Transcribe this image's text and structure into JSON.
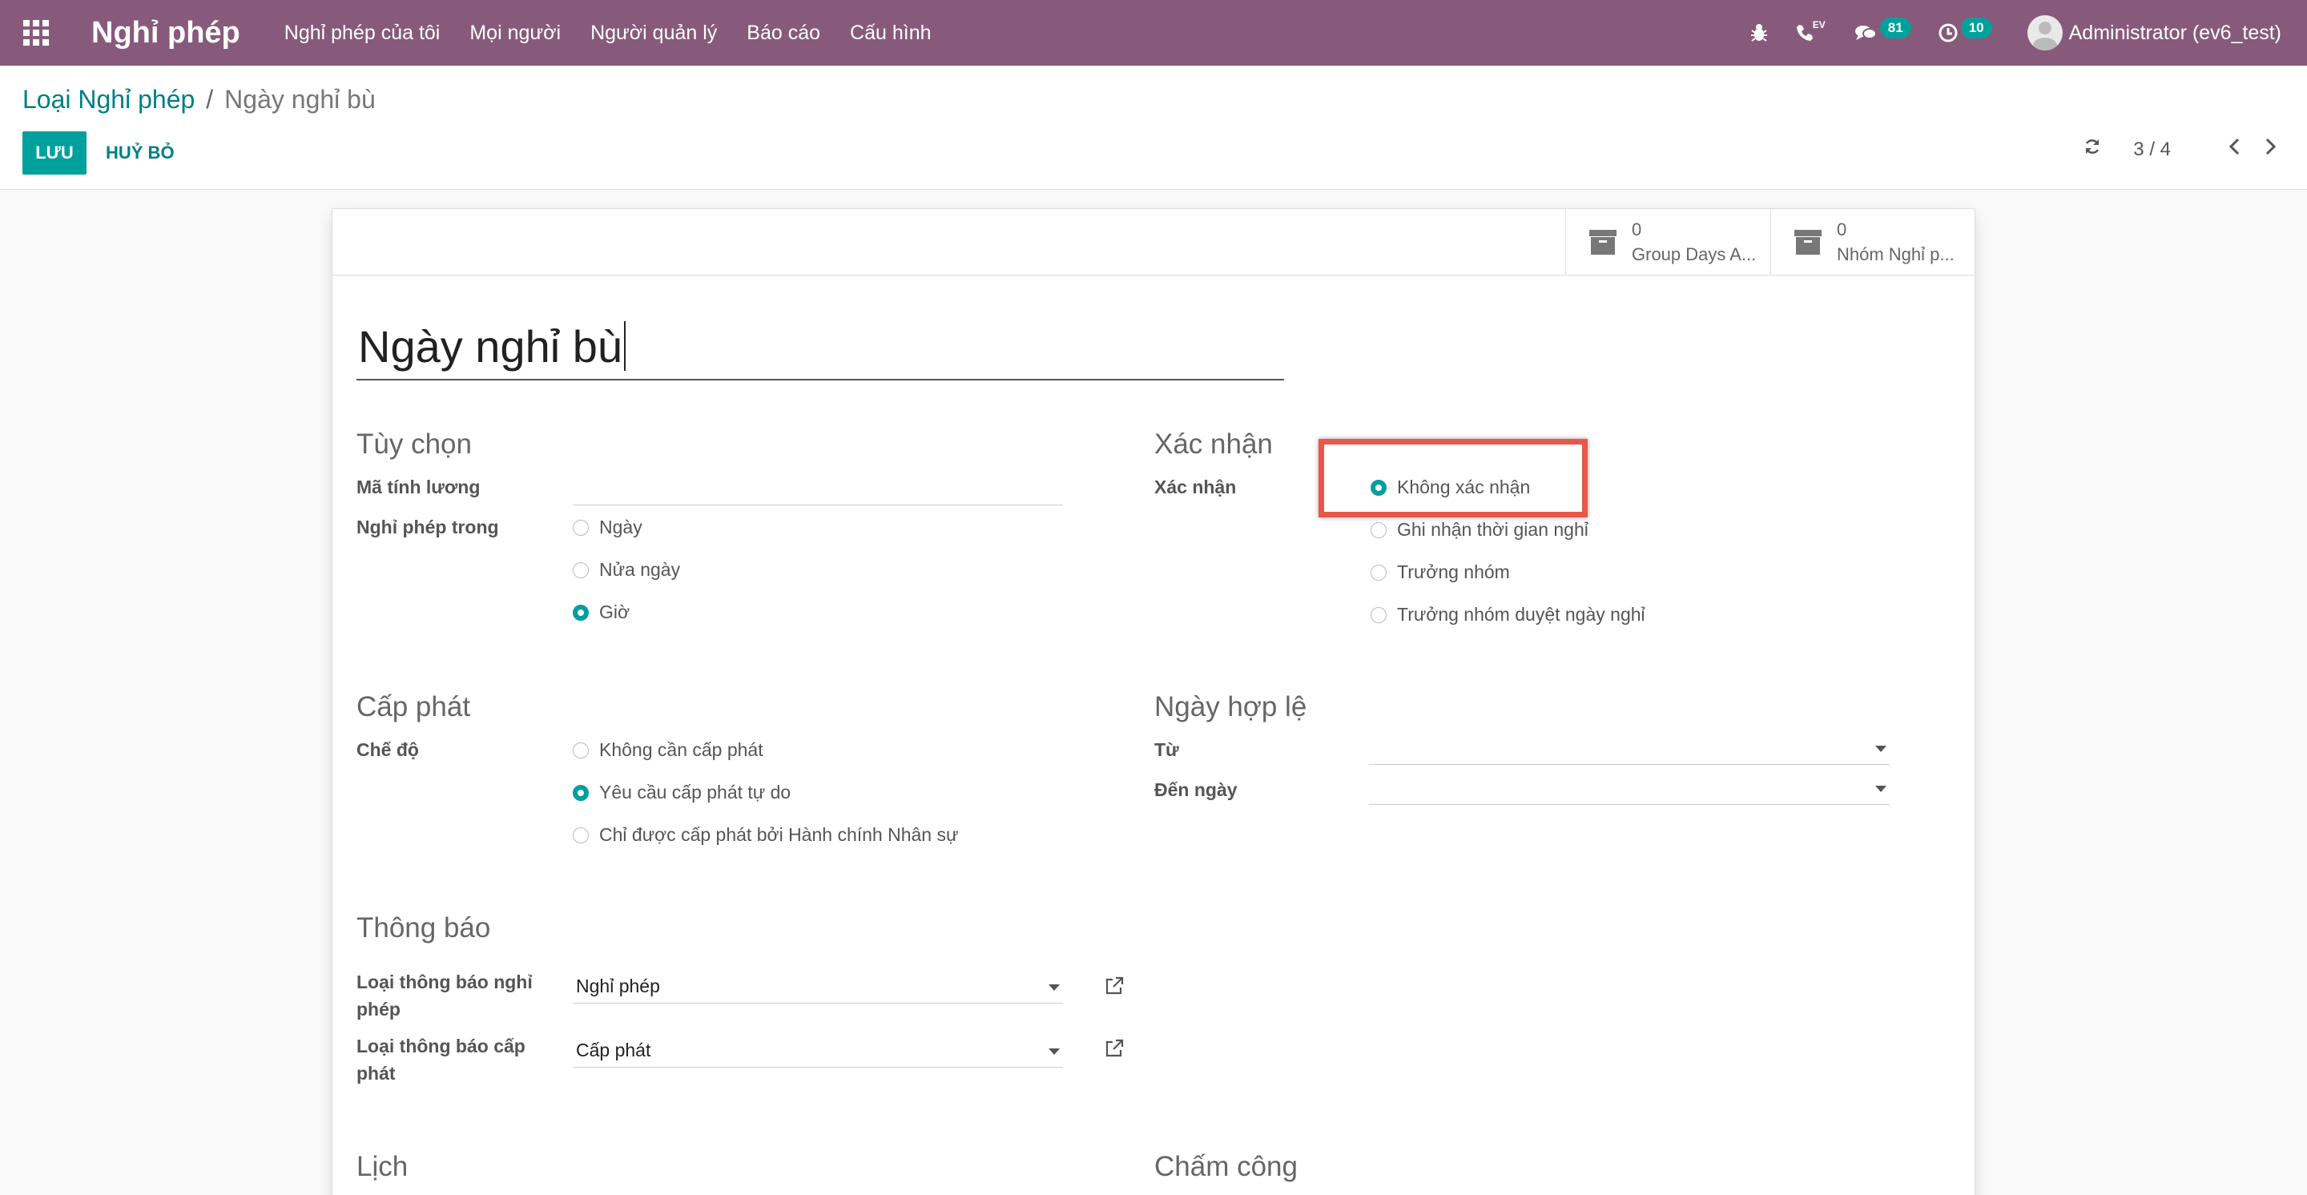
{
  "navbar": {
    "app_name": "Nghỉ phép",
    "menu": [
      "Nghỉ phép của tôi",
      "Mọi người",
      "Người quản lý",
      "Báo cáo",
      "Cấu hình"
    ],
    "ev_tag": "EV",
    "messages_count": "81",
    "activities_count": "10",
    "user": "Administrator (ev6_test)",
    "accent": "#875a7b"
  },
  "control": {
    "breadcrumb_parent": "Loại Nghỉ phép",
    "breadcrumb_sep": "/",
    "breadcrumb_current": "Ngày nghỉ bù",
    "save_label": "LƯU",
    "discard_label": "HUỶ BỎ",
    "pager": "3 / 4"
  },
  "stat_buttons": [
    {
      "value": "0",
      "label": "Group Days A..."
    },
    {
      "value": "0",
      "label": "Nhóm Nghỉ p..."
    }
  ],
  "form": {
    "name": "Ngày nghỉ bù",
    "options": {
      "title": "Tùy chọn",
      "payroll_code_label": "Mã tính lương",
      "payroll_code_value": "",
      "leave_in_label": "Nghỉ phép trong",
      "leave_in_options": [
        "Ngày",
        "Nửa ngày",
        "Giờ"
      ],
      "leave_in_selected": 2
    },
    "validation": {
      "title": "Xác nhận",
      "label": "Xác nhận",
      "options": [
        "Không xác nhận",
        "Ghi nhận thời gian nghỉ",
        "Trưởng nhóm",
        "Trưởng nhóm duyệt ngày nghỉ"
      ],
      "selected": 0
    },
    "allocation": {
      "title": "Cấp phát",
      "mode_label": "Chế độ",
      "options": [
        "Không cần cấp phát",
        "Yêu cầu cấp phát tự do",
        "Chỉ được cấp phát bởi Hành chính Nhân sự"
      ],
      "selected": 1
    },
    "validity": {
      "title": "Ngày hợp lệ",
      "from_label": "Từ",
      "to_label": "Đến ngày",
      "from_value": "",
      "to_value": ""
    },
    "notification": {
      "title": "Thông báo",
      "leave_type_label": "Loại thông báo nghỉ phép",
      "leave_type_value": "Nghỉ phép",
      "alloc_type_label": "Loại thông báo cấp phát",
      "alloc_type_value": "Cấp phát"
    },
    "calendar_title": "Lịch",
    "timesheet_title": "Chấm công"
  }
}
